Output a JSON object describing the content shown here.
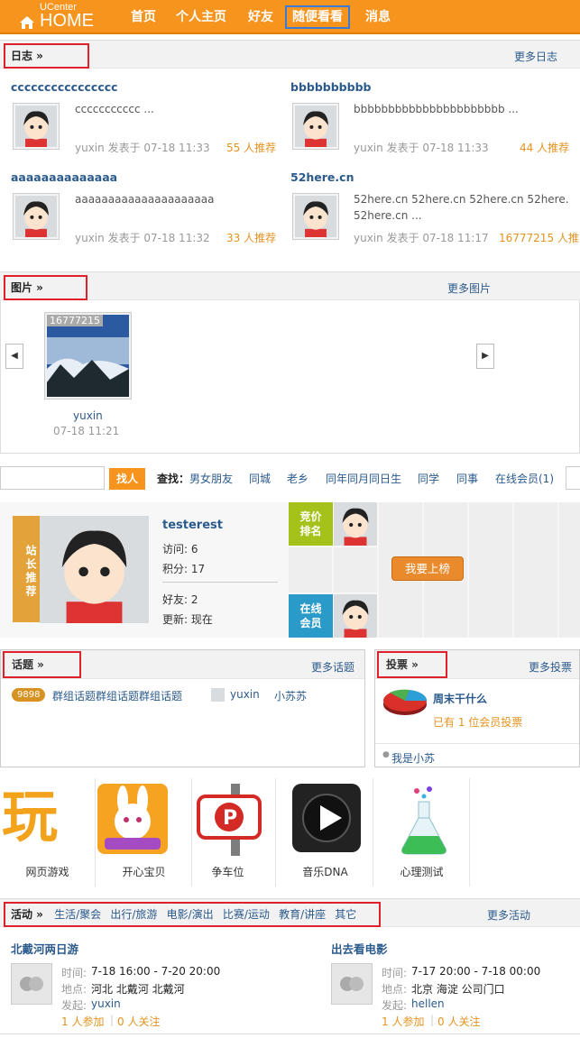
{
  "header": {
    "brand_small": "UCenter",
    "brand": "HOME",
    "nav": [
      "首页",
      "个人主页",
      "好友",
      "随便看看",
      "消息"
    ]
  },
  "blogs": {
    "label": "日志 »",
    "more": "更多日志",
    "items": [
      {
        "title": "cccccccccccccccc",
        "summary": "ccccccccccc ...",
        "meta": "yuxin 发表于 07-18 11:33",
        "rec": "55 人推荐"
      },
      {
        "title": "bbbbbbbbbb",
        "summary": "bbbbbbbbbbbbbbbbbbbbbb ...",
        "meta": "yuxin 发表于 07-18 11:33",
        "rec": "44 人推荐"
      },
      {
        "title": "aaaaaaaaaaaaaa",
        "summary": "aaaaaaaaaaaaaaaaaaaaa",
        "meta": "yuxin 发表于 07-18 11:32",
        "rec": "33 人推荐"
      },
      {
        "title": "52here.cn",
        "summary": "52here.cn 52here.cn 52here.cn 52here.",
        "summary2": "52here.cn ...",
        "meta": "yuxin 发表于 07-18 11:17",
        "rec": "16777215 人推"
      }
    ]
  },
  "photos": {
    "label": "图片 »",
    "more": "更多图片",
    "items": [
      {
        "badge": "16777215",
        "user": "yuxin",
        "time": "07-18 11:21"
      }
    ]
  },
  "search": {
    "button": "找人",
    "find_label": "查找：",
    "links": [
      "男女朋友",
      "同城",
      "老乡",
      "同年同月同日生",
      "同学",
      "同事",
      "在线会员(1)"
    ]
  },
  "recommend": {
    "tag": "站长推荐",
    "username": "testerest",
    "visits": "访问: 6",
    "points": "积分: 17",
    "friends": "好友: 2",
    "updated": "更新: 现在",
    "bid_label": "竞价排名",
    "online_label": "在线会员",
    "rank_button": "我要上榜"
  },
  "topics": {
    "label": "话题 »",
    "more": "更多话题",
    "items": [
      {
        "count": "9898",
        "title": "群组话题群组话题群组话题",
        "user": "yuxin",
        "user2": "小苏苏"
      }
    ]
  },
  "polls": {
    "label": "投票 »",
    "more": "更多投票",
    "title": "周末干什么",
    "voted": "已有 1 位会员投票",
    "author": "我是小苏"
  },
  "apps": [
    "网页游戏",
    "开心宝贝",
    "争车位",
    "音乐DNA",
    "心理测试"
  ],
  "events": {
    "label": "活动 »",
    "cats": [
      "生活/聚会",
      "出行/旅游",
      "电影/演出",
      "比赛/运动",
      "教育/讲座",
      "其它"
    ],
    "more": "更多活动",
    "items": [
      {
        "title": "北戴河两日游",
        "time_label": "时间:",
        "time": "7-18 16:00 - 7-20 20:00",
        "place_label": "地点:",
        "place": "河北 北戴河 北戴河",
        "host_label": "发起:",
        "host": "yuxin",
        "join": "1 人参加",
        "follow": "0 人关注"
      },
      {
        "title": "出去看电影",
        "time_label": "时间:",
        "time": "7-17 20:00 - 7-18 00:00",
        "place_label": "地点:",
        "place": "北京 海淀 公司门口",
        "host_label": "发起:",
        "host": "hellen",
        "join": "1 人参加",
        "follow": "0 人关注"
      }
    ]
  },
  "colors": {
    "header": "#f7941d",
    "link": "#2b5a8c",
    "highlight": "#e0202a",
    "recommend": "#e3931f"
  }
}
